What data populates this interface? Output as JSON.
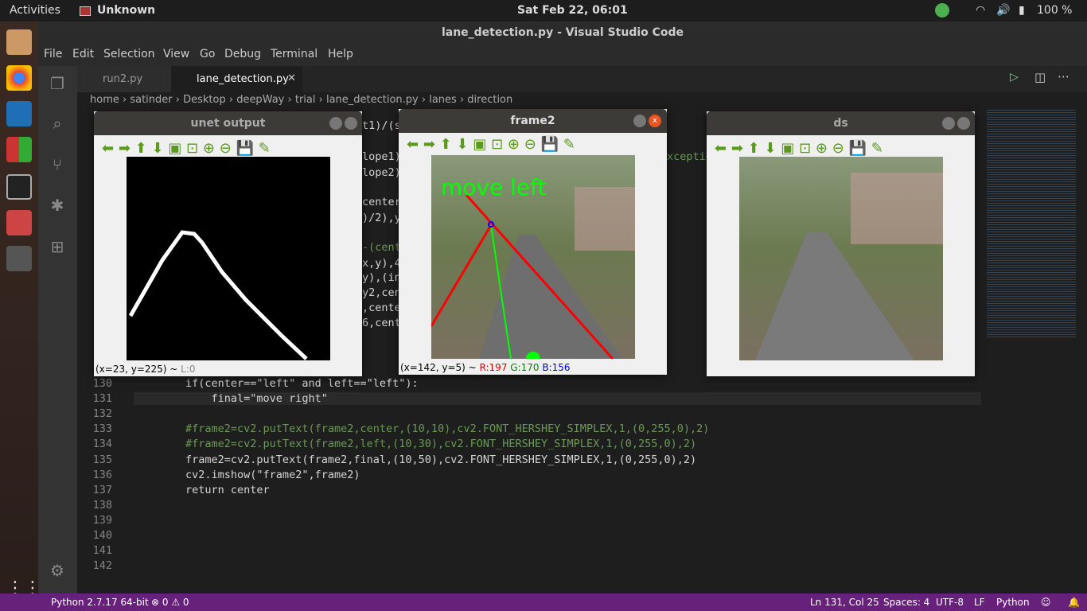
{
  "topbar": {
    "activities": "Activities",
    "app": "Unknown",
    "clock": "Sat Feb 22, 06:01",
    "battery": "100 %"
  },
  "window_title": "lane_detection.py - Visual Studio Code",
  "menu": [
    "File",
    "Edit",
    "Selection",
    "View",
    "Go",
    "Debug",
    "Terminal",
    "Help"
  ],
  "tabs": [
    {
      "label": "run2.py",
      "active": false
    },
    {
      "label": "lane_detection.py",
      "active": true
    }
  ],
  "breadcrumb": [
    "home",
    "satinder",
    "Desktop",
    "deepWay",
    "trial",
    "lane_detection.py",
    "lanes",
    "direction"
  ],
  "code_fragments": [
    "t1)/(s",
    "lope1)",
    "lope2)",
    "center",
    "xceptio",
    ")/2),y",
    "-(cent",
    "x,y),4",
    "y),(in",
    "y2,cen",
    ",cente",
    "6,cent"
  ],
  "code_lines": [
    {
      "n": "130",
      "text": "        if(center==\"left\" and left==\"left\"):"
    },
    {
      "n": "131",
      "text": "            final=\"move right\""
    },
    {
      "n": "132",
      "text": ""
    },
    {
      "n": "133",
      "text": "        #frame2=cv2.putText(frame2,center,(10,10),cv2.FONT_HERSHEY_SIMPLEX,1,(0,255,0),2)"
    },
    {
      "n": "134",
      "text": "        #frame2=cv2.putText(frame2,left,(10,30),cv2.FONT_HERSHEY_SIMPLEX,1,(0,255,0),2)"
    },
    {
      "n": "135",
      "text": "        frame2=cv2.putText(frame2,final,(10,50),cv2.FONT_HERSHEY_SIMPLEX,1,(0,255,0),2)"
    },
    {
      "n": "136",
      "text": "        cv2.imshow(\"frame2\",frame2)"
    },
    {
      "n": "137",
      "text": "        return center"
    },
    {
      "n": "138",
      "text": ""
    },
    {
      "n": "139",
      "text": ""
    },
    {
      "n": "140",
      "text": ""
    },
    {
      "n": "141",
      "text": ""
    },
    {
      "n": "142",
      "text": ""
    }
  ],
  "windows": {
    "unet": {
      "title": "unet output",
      "status": "(x=23, y=225) ~ ",
      "status_l": "L:0"
    },
    "frame2": {
      "title": "frame2",
      "overlay": "move left",
      "status": "(x=142, y=5) ~ ",
      "r": "R:197",
      "g": "G:170",
      "b": "B:156"
    },
    "ds": {
      "title": "ds"
    }
  },
  "statusbar": {
    "python": "Python 2.7.17 64-bit",
    "problems": "⊗ 0 ⚠ 0",
    "position": "Ln 131, Col 25",
    "spaces": "Spaces: 4",
    "encoding": "UTF-8",
    "eol": "LF",
    "language": "Python"
  },
  "colors": {
    "statusbar": "#68217a",
    "lane": "#ff0000",
    "center_line": "#00ff00"
  }
}
